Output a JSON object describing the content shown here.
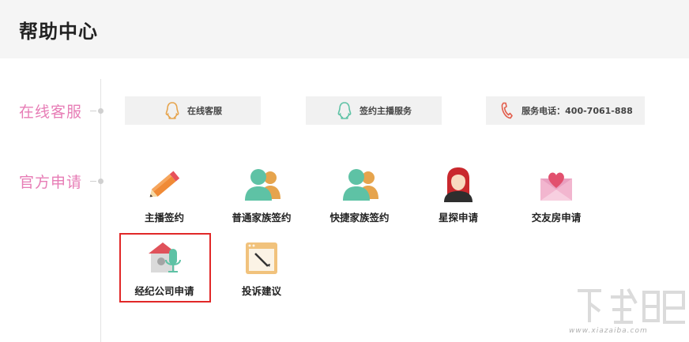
{
  "header": {
    "title": "帮助中心"
  },
  "sections": {
    "service_label": "在线客服",
    "apply_label": "官方申请"
  },
  "service_buttons": [
    {
      "label": "在线客服",
      "icon": "qq-penguin-icon",
      "color": "#e6a44d"
    },
    {
      "label": "签约主播服务",
      "icon": "qq-penguin-icon",
      "color": "#5ec2a5"
    },
    {
      "label": "服务电话：400-7061-888",
      "icon": "phone-icon",
      "color": "#e25c4a"
    }
  ],
  "apply_items": [
    {
      "label": "主播签约",
      "icon": "pencil-icon"
    },
    {
      "label": "普通家族签约",
      "icon": "users-icon"
    },
    {
      "label": "快捷家族签约",
      "icon": "users-icon"
    },
    {
      "label": "星探申请",
      "icon": "woman-avatar-icon"
    },
    {
      "label": "交友房申请",
      "icon": "heart-envelope-icon"
    },
    {
      "label": "经纪公司申请",
      "icon": "house-microphone-icon",
      "selected": true
    },
    {
      "label": "投诉建议",
      "icon": "window-pen-icon"
    }
  ],
  "colors": {
    "accent_pink": "#e77db6",
    "selection_red": "#e12828",
    "teal": "#5ec2a5",
    "orange": "#e6a44d"
  },
  "watermark": {
    "url": "www.xiazaiba.com"
  }
}
